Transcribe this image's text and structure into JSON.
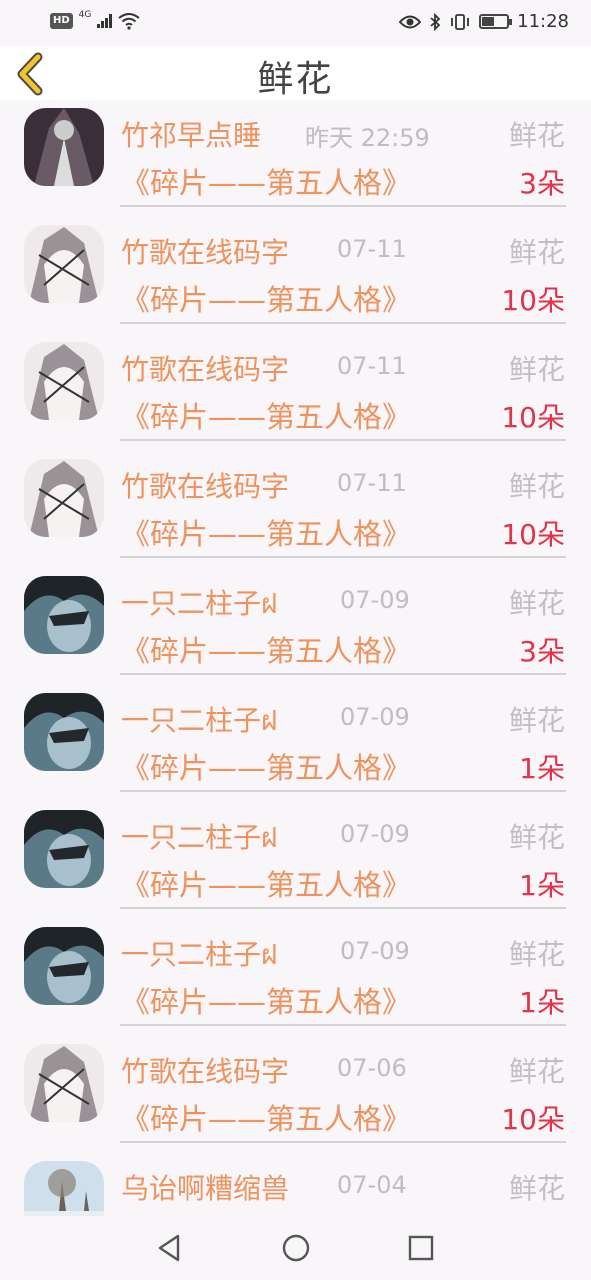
{
  "status_bar": {
    "hd": "HD",
    "network": "4G",
    "time": "11:28"
  },
  "header": {
    "title": "鲜花",
    "back_icon": "chevron-left-icon",
    "back_color": "#f2c62a"
  },
  "colors": {
    "accent": "#ee925e",
    "count": "#e2334a",
    "muted": "#c2bfc2"
  },
  "items": [
    {
      "name": "竹祁早点睡",
      "time": "昨天 22:59",
      "tag": "鲜花",
      "book": "《碎片——第五人格》",
      "count": "3朵",
      "avatar": "avatar-bw"
    },
    {
      "name": "竹歌在线码字",
      "time": "07-11",
      "tag": "鲜花",
      "book": "《碎片——第五人格》",
      "count": "10朵",
      "avatar": "avatar-white"
    },
    {
      "name": "竹歌在线码字",
      "time": "07-11",
      "tag": "鲜花",
      "book": "《碎片——第五人格》",
      "count": "10朵",
      "avatar": "avatar-white"
    },
    {
      "name": "竹歌在线码字",
      "time": "07-11",
      "tag": "鲜花",
      "book": "《碎片——第五人格》",
      "count": "10朵",
      "avatar": "avatar-white"
    },
    {
      "name": "一只二柱子ฝ",
      "time": "07-09",
      "tag": "鲜花",
      "book": "《碎片——第五人格》",
      "count": "3朵",
      "avatar": "avatar-blue"
    },
    {
      "name": "一只二柱子ฝ",
      "time": "07-09",
      "tag": "鲜花",
      "book": "《碎片——第五人格》",
      "count": "1朵",
      "avatar": "avatar-blue"
    },
    {
      "name": "一只二柱子ฝ",
      "time": "07-09",
      "tag": "鲜花",
      "book": "《碎片——第五人格》",
      "count": "1朵",
      "avatar": "avatar-blue"
    },
    {
      "name": "一只二柱子ฝ",
      "time": "07-09",
      "tag": "鲜花",
      "book": "《碎片——第五人格》",
      "count": "1朵",
      "avatar": "avatar-blue"
    },
    {
      "name": "竹歌在线码字",
      "time": "07-06",
      "tag": "鲜花",
      "book": "《碎片——第五人格》",
      "count": "10朵",
      "avatar": "avatar-white"
    },
    {
      "name": "乌诒啊糟缩兽",
      "time": "07-04",
      "tag": "鲜花",
      "book": "",
      "count": "",
      "avatar": "avatar-snow"
    }
  ],
  "nav": {
    "back": "triangle-back-icon",
    "home": "circle-home-icon",
    "recent": "square-recent-icon"
  }
}
